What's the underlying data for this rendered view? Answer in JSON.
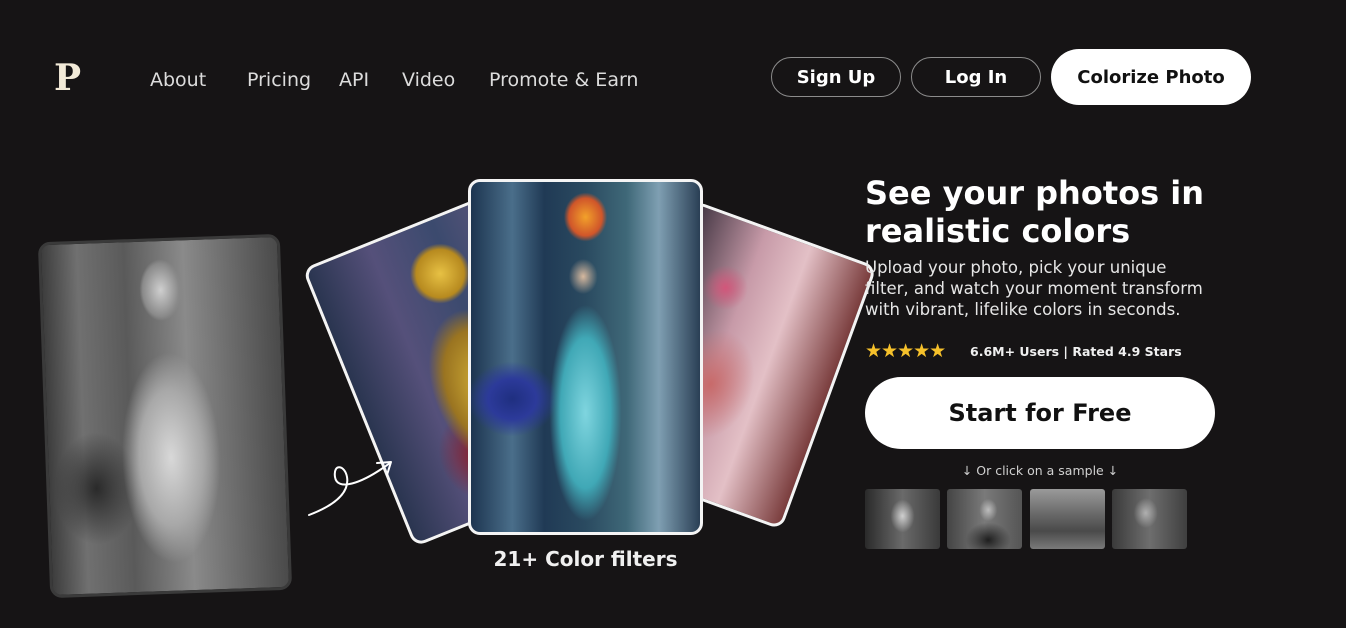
{
  "header": {
    "logo": "P",
    "nav": [
      "About",
      "Pricing",
      "API",
      "Video",
      "Promote & Earn"
    ],
    "sign_up": "Sign Up",
    "log_in": "Log In",
    "colorize": "Colorize Photo"
  },
  "showcase": {
    "filters_label": "21+ Color filters"
  },
  "hero": {
    "headline": "See your photos in realistic colors",
    "subtext": "Upload your photo, pick your unique filter, and watch your moment transform with vibrant, lifelike colors in seconds.",
    "stars": "★★★★★",
    "rating_count": 5,
    "rating_text": "6.6M+ Users | Rated 4.9 Stars",
    "cta": "Start for Free",
    "sample_hint": "↓ Or click on a sample ↓"
  },
  "colors": {
    "background": "#161415",
    "star": "#f6c12b",
    "button_bg": "#ffffff"
  }
}
